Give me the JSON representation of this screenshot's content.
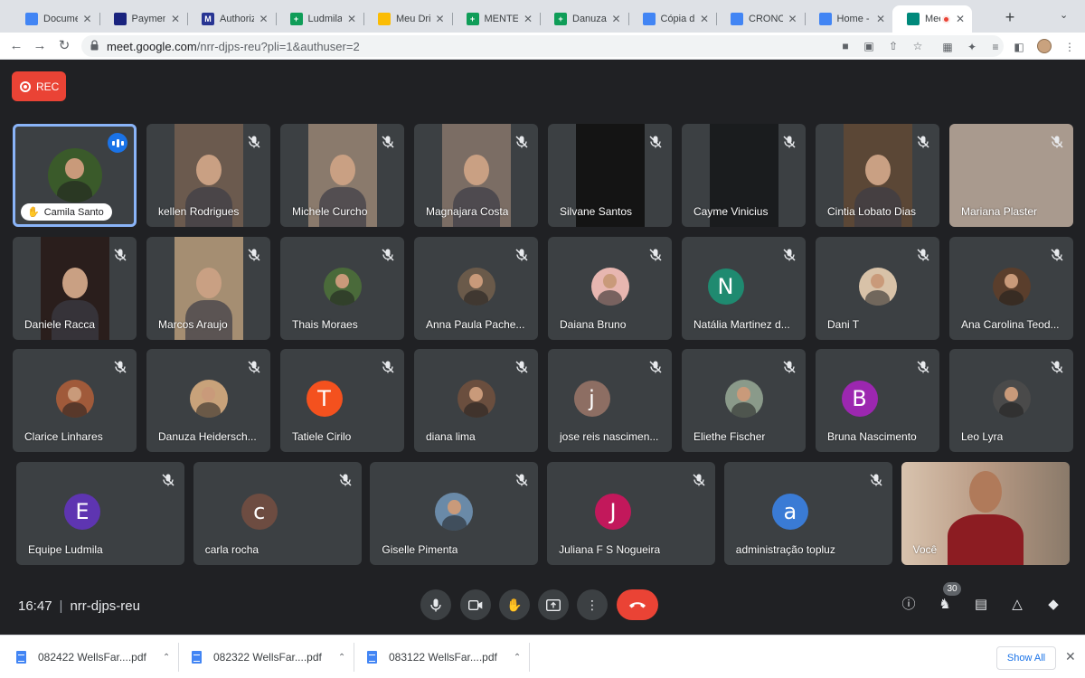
{
  "browser": {
    "tabs": [
      {
        "title": "Documen",
        "icon": "google-docs-icon",
        "color": "#4285f4",
        "glyph": ""
      },
      {
        "title": "Payment",
        "icon": "payment-icon",
        "color": "#1a237e",
        "glyph": ""
      },
      {
        "title": "Authorize",
        "icon": "m-logo-icon",
        "color": "#283593",
        "glyph": "M"
      },
      {
        "title": "Ludmila P",
        "icon": "google-sheets-icon",
        "color": "#0f9d58",
        "glyph": "+"
      },
      {
        "title": "Meu Drive",
        "icon": "google-drive-icon",
        "color": "#fbbc04",
        "glyph": ""
      },
      {
        "title": "MENTE D",
        "icon": "google-sheets-icon",
        "color": "#0f9d58",
        "glyph": "+"
      },
      {
        "title": "Danuza S",
        "icon": "google-sheets-icon",
        "color": "#0f9d58",
        "glyph": "+"
      },
      {
        "title": "Cópia de",
        "icon": "google-docs-icon",
        "color": "#4285f4",
        "glyph": ""
      },
      {
        "title": "CRONOG",
        "icon": "google-docs-icon",
        "color": "#4285f4",
        "glyph": ""
      },
      {
        "title": "Home - C",
        "icon": "chrome-icon",
        "color": "#4285f4",
        "glyph": ""
      },
      {
        "title": "Meet",
        "icon": "google-meet-icon",
        "color": "#00897b",
        "glyph": ""
      }
    ],
    "url_host": "meet.google.com",
    "url_path": "/nrr-djps-reu?pli=1&authuser=2"
  },
  "meet": {
    "rec_label": "REC",
    "participants": [
      {
        "name": "Camila Santo",
        "type": "photo",
        "color": "#3a5a2a",
        "hand_raised": true,
        "speaking": true,
        "muted": false
      },
      {
        "name": "kellen Rodrigues",
        "type": "video",
        "color": "#6b5a4e",
        "muted": true
      },
      {
        "name": "Michele Curcho",
        "type": "video",
        "color": "#8a7a6c",
        "muted": true
      },
      {
        "name": "Magnajara Costa",
        "type": "video",
        "color": "#7b6d64",
        "muted": true
      },
      {
        "name": "Silvane Santos",
        "type": "video",
        "color": "#141414",
        "muted": true
      },
      {
        "name": "Cayme Vinicius",
        "type": "video",
        "color": "#1a1c1e",
        "muted": true
      },
      {
        "name": "Cintia Lobato Dias",
        "type": "video",
        "color": "#5b4736",
        "muted": true
      },
      {
        "name": "Mariana Plaster",
        "type": "video",
        "color": "#a99a8e",
        "muted": true
      },
      {
        "name": "Daniele Racca",
        "type": "video",
        "color": "#2a1e1c",
        "muted": true
      },
      {
        "name": "Marcos Araujo",
        "type": "video",
        "color": "#a58e72",
        "muted": true
      },
      {
        "name": "Thais Moraes",
        "type": "photo",
        "color": "#4a6a3a",
        "muted": true
      },
      {
        "name": "Anna Paula Pache...",
        "type": "photo",
        "color": "#6a5a4a",
        "muted": true
      },
      {
        "name": "Daiana Bruno",
        "type": "photo",
        "color": "#e7b6b0",
        "muted": true
      },
      {
        "name": "Natália Martinez d...",
        "type": "letter",
        "letter": "N",
        "color": "#1f8a70",
        "muted": true
      },
      {
        "name": "Dani T",
        "type": "photo",
        "color": "#d8c2a8",
        "muted": true
      },
      {
        "name": "Ana Carolina Teod...",
        "type": "photo",
        "color": "#5a3e2c",
        "muted": true
      },
      {
        "name": "Clarice Linhares",
        "type": "photo",
        "color": "#a05a3a",
        "muted": true
      },
      {
        "name": "Danuza Heidersch...",
        "type": "photo",
        "color": "#c8a27a",
        "muted": true
      },
      {
        "name": "Tatiele Cirilo",
        "type": "letter",
        "letter": "T",
        "color": "#f4511e",
        "muted": true
      },
      {
        "name": "diana lima",
        "type": "photo",
        "color": "#6a4e3e",
        "muted": true
      },
      {
        "name": "jose reis nascimen...",
        "type": "letter",
        "letter": "j",
        "color": "#8d6e63",
        "muted": true
      },
      {
        "name": "Eliethe Fischer",
        "type": "photo",
        "color": "#8a9a8a",
        "muted": true
      },
      {
        "name": "Bruna Nascimento",
        "type": "letter",
        "letter": "B",
        "color": "#9c27b0",
        "muted": true
      },
      {
        "name": "Leo Lyra",
        "type": "photo",
        "color": "#4a4a4a",
        "muted": true
      },
      {
        "name": "Equipe Ludmila",
        "type": "letter",
        "letter": "E",
        "color": "#5e35b1",
        "muted": true
      },
      {
        "name": "carla rocha",
        "type": "letter",
        "letter": "c",
        "color": "#6d4c41",
        "muted": true
      },
      {
        "name": "Giselle Pimenta",
        "type": "photo",
        "color": "#6a8aa8",
        "muted": true
      },
      {
        "name": "Juliana F S Nogueira",
        "type": "letter",
        "letter": "J",
        "color": "#c2185b",
        "muted": true
      },
      {
        "name": "administração topluz",
        "type": "letter",
        "letter": "a",
        "color": "#3a7bd5",
        "muted": true
      },
      {
        "name": "Você",
        "type": "self-video",
        "color": "#b89a84",
        "muted": false
      }
    ],
    "bottom": {
      "time": "16:47",
      "meeting_code": "nrr-djps-reu",
      "participants_count": "30"
    }
  },
  "downloads": {
    "items": [
      "082422 WellsFar....pdf",
      "082322 WellsFar....pdf",
      "083122 WellsFar....pdf"
    ],
    "show_all": "Show All"
  }
}
